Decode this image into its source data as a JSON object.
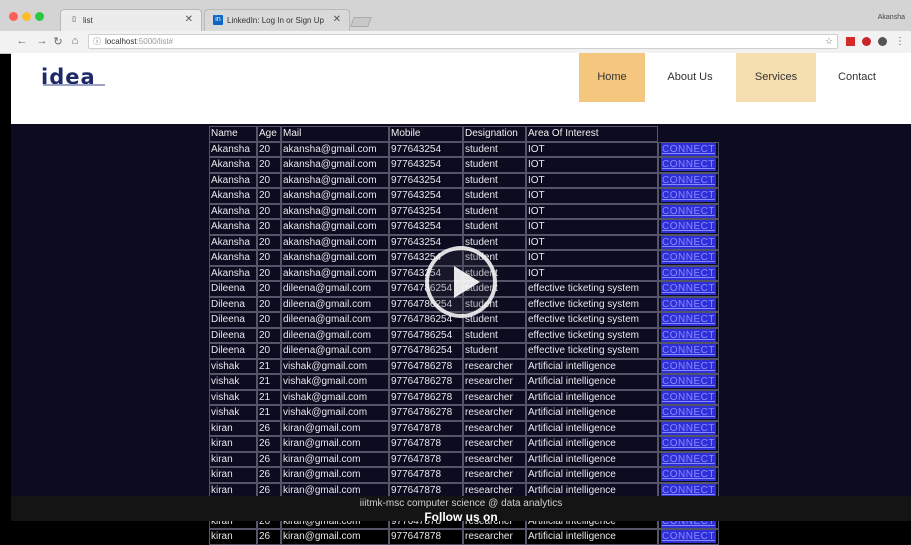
{
  "browser": {
    "tabs": [
      {
        "label": "list",
        "favicon": "page-icon"
      },
      {
        "label": "LinkedIn: Log In or Sign Up",
        "favicon": "in"
      }
    ],
    "profile_name": "Akansha",
    "url_host": "localhost",
    "url_port": ":5000/list#"
  },
  "site": {
    "logo": "idea",
    "nav": [
      {
        "label": "Home",
        "state": "active"
      },
      {
        "label": "About Us",
        "state": "normal"
      },
      {
        "label": "Services",
        "state": "highlight"
      },
      {
        "label": "Contact",
        "state": "normal"
      }
    ]
  },
  "table": {
    "headers": [
      "Name",
      "Age",
      "Mail",
      "Mobile",
      "Designation",
      "Area Of Interest",
      ""
    ],
    "connect_label": "CONNECT",
    "rows": [
      [
        "Akansha",
        "20",
        "akansha@gmail.com",
        "977643254",
        "student",
        "IOT"
      ],
      [
        "Akansha",
        "20",
        "akansha@gmail.com",
        "977643254",
        "student",
        "IOT"
      ],
      [
        "Akansha",
        "20",
        "akansha@gmail.com",
        "977643254",
        "student",
        "IOT"
      ],
      [
        "Akansha",
        "20",
        "akansha@gmail.com",
        "977643254",
        "student",
        "IOT"
      ],
      [
        "Akansha",
        "20",
        "akansha@gmail.com",
        "977643254",
        "student",
        "IOT"
      ],
      [
        "Akansha",
        "20",
        "akansha@gmail.com",
        "977643254",
        "student",
        "IOT"
      ],
      [
        "Akansha",
        "20",
        "akansha@gmail.com",
        "977643254",
        "student",
        "IOT"
      ],
      [
        "Akansha",
        "20",
        "akansha@gmail.com",
        "977643254",
        "student",
        "IOT"
      ],
      [
        "Akansha",
        "20",
        "akansha@gmail.com",
        "977643254",
        "student",
        "IOT"
      ],
      [
        "Dileena",
        "20",
        "dileena@gmail.com",
        "97764786254",
        "student",
        "effective ticketing system"
      ],
      [
        "Dileena",
        "20",
        "dileena@gmail.com",
        "97764786254",
        "student",
        "effective ticketing system"
      ],
      [
        "Dileena",
        "20",
        "dileena@gmail.com",
        "97764786254",
        "student",
        "effective ticketing system"
      ],
      [
        "Dileena",
        "20",
        "dileena@gmail.com",
        "97764786254",
        "student",
        "effective ticketing system"
      ],
      [
        "Dileena",
        "20",
        "dileena@gmail.com",
        "97764786254",
        "student",
        "effective ticketing system"
      ],
      [
        "vishak",
        "21",
        "vishak@gmail.com",
        "97764786278",
        "researcher",
        "Artificial intelligence"
      ],
      [
        "vishak",
        "21",
        "vishak@gmail.com",
        "97764786278",
        "researcher",
        "Artificial intelligence"
      ],
      [
        "vishak",
        "21",
        "vishak@gmail.com",
        "97764786278",
        "researcher",
        "Artificial intelligence"
      ],
      [
        "vishak",
        "21",
        "vishak@gmail.com",
        "97764786278",
        "researcher",
        "Artificial intelligence"
      ],
      [
        "kiran",
        "26",
        "kiran@gmail.com",
        "977647878",
        "researcher",
        "Artificial intelligence"
      ],
      [
        "kiran",
        "26",
        "kiran@gmail.com",
        "977647878",
        "researcher",
        "Artificial intelligence"
      ],
      [
        "kiran",
        "26",
        "kiran@gmail.com",
        "977647878",
        "researcher",
        "Artificial intelligence"
      ],
      [
        "kiran",
        "26",
        "kiran@gmail.com",
        "977647878",
        "researcher",
        "Artificial intelligence"
      ],
      [
        "kiran",
        "26",
        "kiran@gmail.com",
        "977647878",
        "researcher",
        "Artificial intelligence"
      ],
      [
        "kiran",
        "26",
        "kiran@gmail.com",
        "977647878",
        "researcher",
        "Artificial intelligence"
      ],
      [
        "kiran",
        "26",
        "kiran@gmail.com",
        "977647878",
        "researcher",
        "Artificial intelligence"
      ],
      [
        "kiran",
        "26",
        "kiran@gmail.com",
        "977647878",
        "researcher",
        "Artificial intelligence"
      ]
    ]
  },
  "footer": {
    "text": "iiitmk-msc computer science @ data analytics",
    "follow": "Follow us on"
  },
  "colors": {
    "page_bg": "#0d0b20",
    "nav_active": "#f5c77e",
    "nav_highlight": "#f5deb0",
    "connect_bg": "#2f2fd8",
    "connect_text": "#8a8aff"
  }
}
